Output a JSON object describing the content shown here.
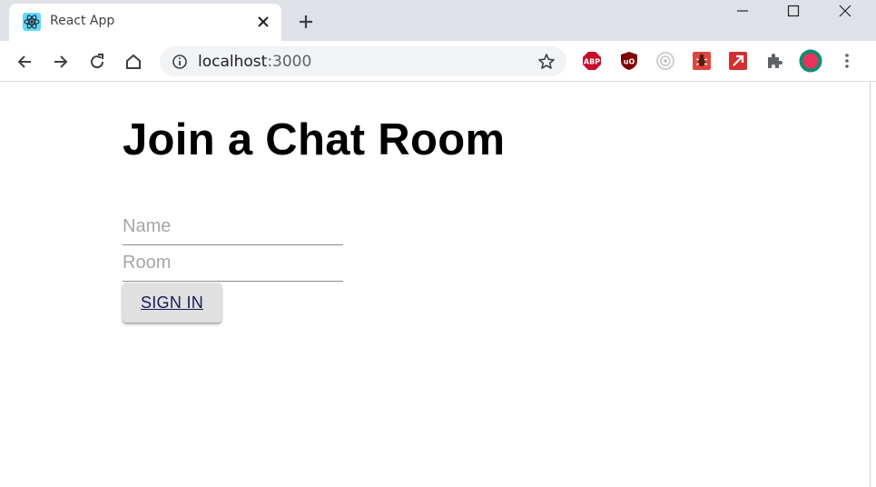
{
  "browser": {
    "tab": {
      "title": "React App",
      "favicon": "react-logo-icon",
      "close_icon": "close-icon"
    },
    "new_tab_icon": "plus-icon",
    "window_controls": [
      "minimize-icon",
      "maximize-icon",
      "close-icon"
    ],
    "nav": [
      "back-arrow-icon",
      "forward-arrow-icon",
      "reload-icon",
      "home-icon"
    ],
    "address": {
      "host": "localhost",
      "port": ":3000",
      "info_icon": "info-icon",
      "bookmark_icon": "star-icon"
    },
    "extensions": [
      {
        "name": "adblock-plus-extension",
        "label": "ABP",
        "color": "#c70d2c"
      },
      {
        "name": "ublock-origin-extension",
        "label": "uO",
        "color": "#800000"
      },
      {
        "name": "circle-extension",
        "label": "",
        "color": "#cfcfcf"
      },
      {
        "name": "bug-extension",
        "label": "",
        "color": "#e0463d"
      },
      {
        "name": "arrow-extension",
        "label": "",
        "color": "#d32f2f"
      },
      {
        "name": "extensions-puzzle-icon",
        "label": "",
        "color": "#5f6368"
      },
      {
        "name": "profile-avatar",
        "label": "",
        "color": "#e8335c"
      },
      {
        "name": "menu-dots-icon",
        "label": "",
        "color": "#5f6368"
      }
    ]
  },
  "page": {
    "heading": "Join a Chat Room",
    "name_placeholder": "Name",
    "room_placeholder": "Room",
    "signin_label": "SIGN IN"
  }
}
